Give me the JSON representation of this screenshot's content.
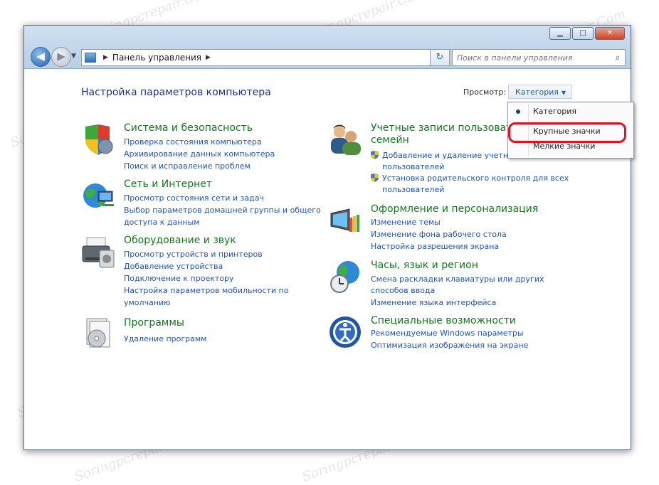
{
  "window": {
    "minimize": "▁",
    "maximize": "□",
    "close": "✕"
  },
  "nav": {
    "back_glyph": "◀",
    "forward_glyph": "▶",
    "history_glyph": "▼",
    "refresh_glyph": "↻"
  },
  "address": {
    "path": "Панель управления",
    "separator": "▶",
    "drop_glyph": "▼"
  },
  "search": {
    "placeholder": "Поиск в панели управления",
    "icon": "search-icon"
  },
  "heading": "Настройка параметров компьютера",
  "view": {
    "label": "Просмотр:",
    "current": "Категория",
    "arrow": "▼",
    "options": [
      "Категория",
      "Крупные значки",
      "Мелкие значки"
    ],
    "selected_index": 0,
    "highlighted_option": "Крупные значки",
    "highlight_color": "#e8101c"
  },
  "categories": {
    "security": {
      "title": "Система и безопасность",
      "links": [
        "Проверка состояния компьютера",
        "Архивирование данных компьютера",
        "Поиск и исправление проблем"
      ]
    },
    "network": {
      "title": "Сеть и Интернет",
      "links": [
        "Просмотр состояния сети и задач",
        "Выбор параметров домашней группы и общего",
        "доступа к данным"
      ]
    },
    "hardware": {
      "title": "Оборудование и звук",
      "links": [
        "Просмотр устройств и принтеров",
        "Добавление устройства",
        "Подключение к проектору",
        "Настройка параметров мобильности по",
        "умолчанию"
      ]
    },
    "programs": {
      "title": "Программы",
      "links": [
        "Удаление программ"
      ]
    },
    "accounts": {
      "title_line1": "Учетные записи пользоват",
      "title_line2": "семейн",
      "links": [
        "Добавление и удаление учетны",
        "пользователей",
        "Установка родительского контроля для всех",
        "пользователей"
      ]
    },
    "appearance": {
      "title": "Оформление и персонализация",
      "links": [
        "Изменение темы",
        "Изменение фона рабочего стола",
        "Настройка разрешения экрана"
      ]
    },
    "clock": {
      "title": "Часы, язык и регион",
      "links": [
        "Смена раскладки клавиатуры или других",
        "способов ввода",
        "Изменение языка интерфейса"
      ]
    },
    "access": {
      "title": "Специальные возможности",
      "links": [
        "Рекомендуемые Windows параметры",
        "Оптимизация изображения на экране"
      ]
    }
  },
  "watermark": "Soringpcrepair.Com",
  "colors": {
    "title_green": "#127a1d",
    "link_blue": "#1d54c8",
    "heading_blue": "#1e3287"
  }
}
